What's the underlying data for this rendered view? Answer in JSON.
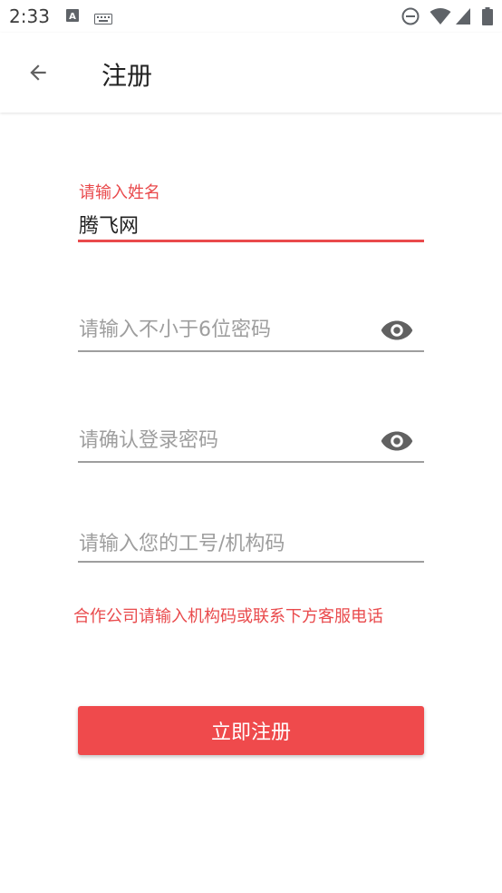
{
  "status_bar": {
    "time": "2:33",
    "icons": [
      "a-notification-icon",
      "keyboard-icon",
      "do-not-disturb-icon",
      "wifi-icon",
      "cell-signal-icon",
      "battery-icon"
    ]
  },
  "app_bar": {
    "back_icon": "arrow-back-icon",
    "title": "注册"
  },
  "form": {
    "name": {
      "label": "请输入姓名",
      "value": "腾飞网"
    },
    "password": {
      "placeholder": "请输入不小于6位密码",
      "toggle_icon": "eye-icon"
    },
    "confirm_password": {
      "placeholder": "请确认登录密码",
      "toggle_icon": "eye-icon"
    },
    "employee_id": {
      "placeholder": "请输入您的工号/机构码"
    },
    "hint": "合作公司请输入机构码或联系下方客服电话",
    "submit_label": "立即注册"
  },
  "colors": {
    "accent": "#ef4a4c",
    "label_red": "#e94a4c",
    "underline": "#9e9e9e",
    "placeholder": "#9e9e9e",
    "text": "#222222"
  }
}
